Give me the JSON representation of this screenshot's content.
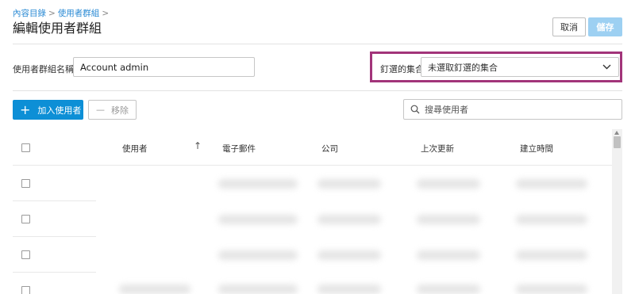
{
  "breadcrumb": {
    "item1": "內容目錄",
    "sep": ">",
    "item2": "使用者群組"
  },
  "page_title": "編輯使用者群組",
  "header_buttons": {
    "cancel": "取消",
    "save": "儲存"
  },
  "form": {
    "group_name_label": "使用者群組名稱",
    "required_marker": "*",
    "group_name_value": "Account admin",
    "pinned_label": "釘選的集合",
    "pinned_value": "未選取釘選的集合"
  },
  "toolbar": {
    "add_label": "加入使用者",
    "add_icon": "+",
    "remove_label": "移除",
    "remove_icon": "—",
    "search_placeholder": "搜尋使用者"
  },
  "table": {
    "columns": [
      "使用者",
      "電子郵件",
      "公司",
      "上次更新",
      "建立時間"
    ],
    "sort_indicator": "↑"
  },
  "colors": {
    "accent": "#0d8fd6",
    "highlight": "#a2347a",
    "save_disabled": "#9dd0f2"
  }
}
